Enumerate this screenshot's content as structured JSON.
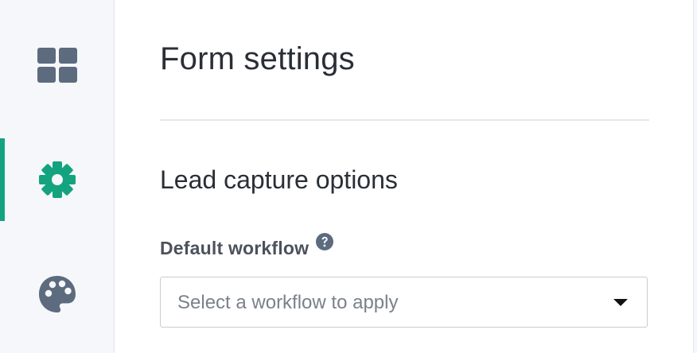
{
  "sidebar": {
    "items": [
      {
        "icon": "dashboard-grid-icon",
        "active": false
      },
      {
        "icon": "gear-icon",
        "active": true
      },
      {
        "icon": "palette-icon",
        "active": false
      }
    ],
    "active_color": "#14a37f",
    "icon_color": "#5d6b7f"
  },
  "main": {
    "title": "Form settings",
    "section": {
      "title": "Lead capture options",
      "fields": [
        {
          "label": "Default workflow",
          "help_icon": "question-circle-icon",
          "select": {
            "placeholder": "Select a workflow to apply",
            "selected": ""
          }
        }
      ]
    }
  }
}
